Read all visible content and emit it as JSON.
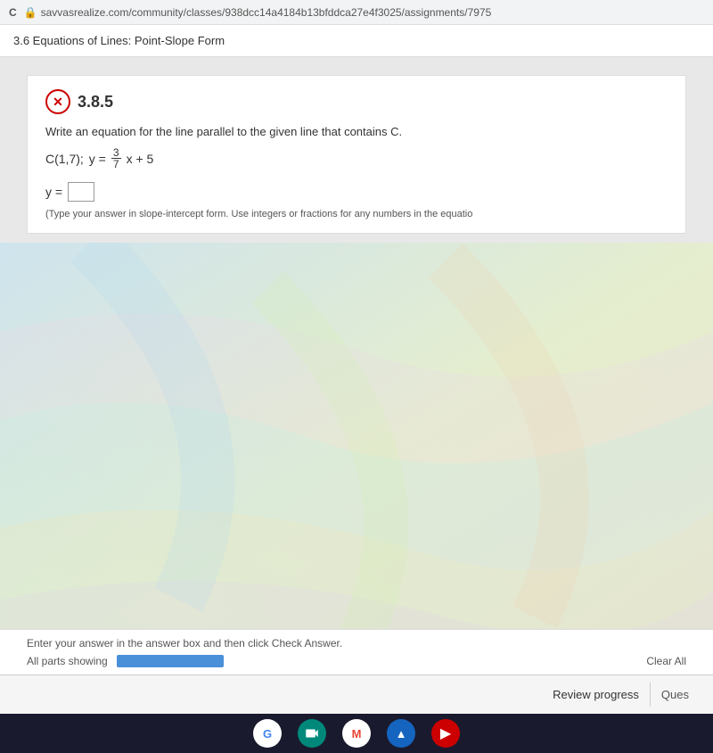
{
  "browser": {
    "url": "savvasrealize.com/community/classes/938dcc14a4184b13bfddca27e4f3025/assignments/7975",
    "reload_label": "C"
  },
  "topnav": {
    "title": "3.6 Equations of Lines: Point-Slope Form"
  },
  "problem": {
    "number": "3.8.5",
    "instruction": "Write an equation for the line parallel to the given line that contains C.",
    "given": "C(1,7);",
    "equation_prefix": "y =",
    "fraction_num": "3",
    "fraction_den": "7",
    "equation_suffix": "x + 5",
    "answer_label": "y =",
    "answer_placeholder": "",
    "hint": "(Type your answer in slope-intercept form. Use integers or fractions for any numbers in the equatio"
  },
  "bottom_bar": {
    "instruction": "Enter your answer in the answer box and then click Check Answer.",
    "all_parts_label": "All parts showing",
    "clear_all_label": "Clear All"
  },
  "footer": {
    "review_progress_label": "Review progress",
    "question_label": "Ques"
  },
  "taskbar": {
    "icons": [
      "G",
      "▶",
      "M",
      "▲",
      "▶"
    ]
  }
}
